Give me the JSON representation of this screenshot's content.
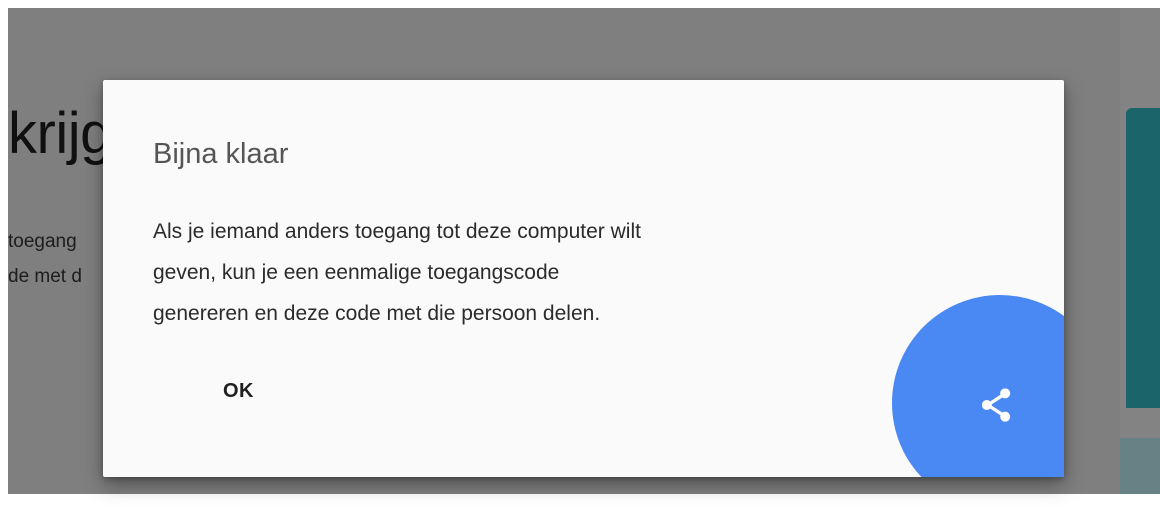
{
  "background": {
    "heading": "krijg",
    "line1": "toegang",
    "line2": "de met d"
  },
  "dialog": {
    "title": "Bijna klaar",
    "body_lines": [
      "Als je iemand anders toegang tot deze computer wilt",
      "geven, kun je een eenmalige toegangscode",
      "genereren en deze code met die persoon delen."
    ],
    "ok_label": "OK",
    "share_button_icon": "share-icon"
  },
  "colors": {
    "accent": "#4a89f3",
    "dialog_background": "#fafafa",
    "scrim": "rgba(0,0,0,0.5)"
  }
}
